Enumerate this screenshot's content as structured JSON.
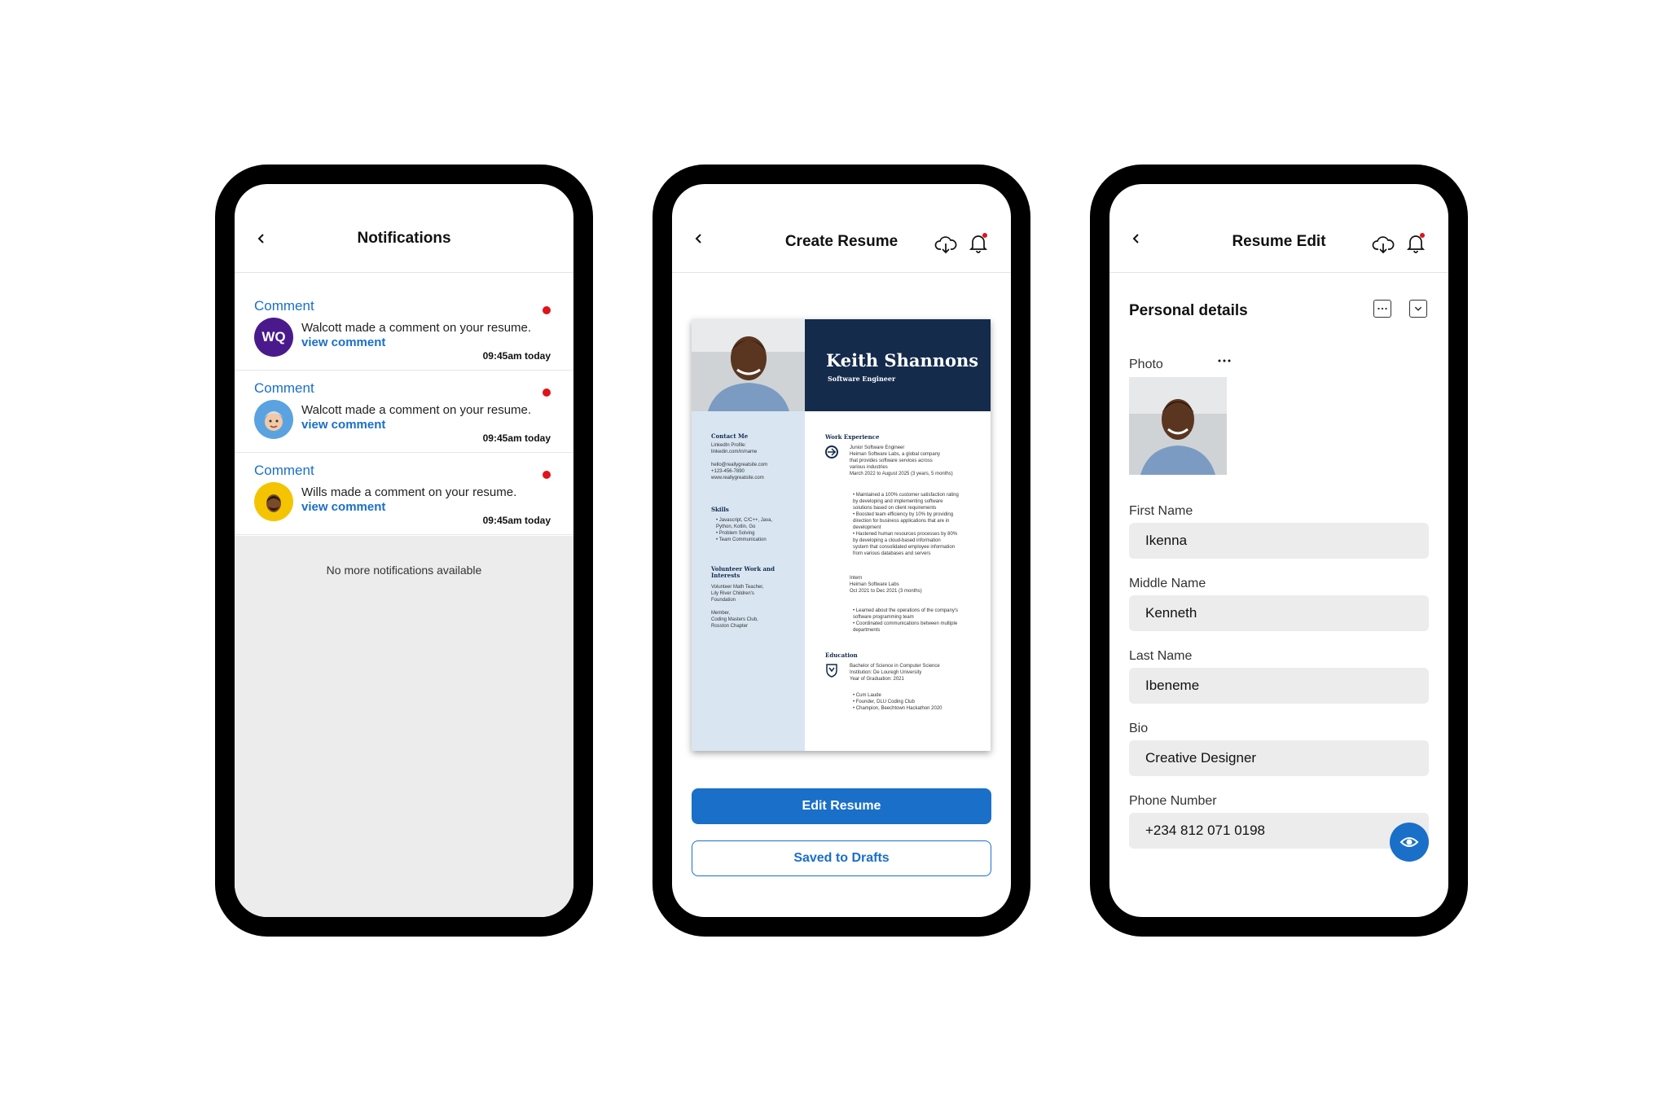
{
  "notifications_screen": {
    "title": "Notifications",
    "items": [
      {
        "type": "Comment",
        "message": "Walcott made a comment on your resume.",
        "link": "view comment",
        "time": "09:45am today",
        "avatar_initials": "WQ",
        "avatar_color": "#4a1a8c"
      },
      {
        "type": "Comment",
        "message": "Walcott made a comment on your resume.",
        "link": "view comment",
        "time": "09:45am today",
        "avatar_color": "#5aa3e0"
      },
      {
        "type": "Comment",
        "message": "Wills made a comment on your resume.",
        "link": "view comment",
        "time": "09:45am today",
        "avatar_color": "#f5c400"
      }
    ],
    "empty_text": "No more notifications available"
  },
  "create_screen": {
    "title": "Create Resume",
    "resume": {
      "name": "Keith Shannons",
      "role": "Software Engineer",
      "contact_title": "Contact Me",
      "contact_lines": "LinkedIn Profile:\nlinkedin.com/in/name\n\nhello@reallygreatsite.com\n+123-456-7890\nwww.reallygreatsite.com",
      "skills_title": "Skills",
      "skills_lines": "•  Javascript, C/C++, Java,\n    Python, Kotlin, Go\n•  Problem Solving\n•  Team Communication",
      "volunteer_title": "Volunteer Work and Interests",
      "volunteer_lines": "Volunteer Math Teacher,\nLily River Children's\nFoundation\n\nMember,\nCoding Masters Club,\nRosston Chapter",
      "work_title": "Work Experience",
      "job1_lines": "Junior Software Engineer\nHeiman Software Labs, a global company\nthat provides software services across\nvarious industries\nMarch 2022 to August 2025 (3 years, 5 months)",
      "job1_bullets": "•  Maintained a 100% customer satisfaction rating\n    by developing and implementing software\n    solutions based on client requirements\n•  Boosted team efficiency by 10% by providing\n    direction for business applications that are in\n    development\n•  Hastened human resources processes by 80%\n    by developing a cloud-based information\n    system that consolidated employee information\n    from various databases and servers",
      "job2_lines": "Intern\nHeiman Software Labs\nOct 2021 to Dec 2021 (3 months)",
      "job2_bullets": "•  Learned about the operations of the company's\n    software programming team\n•  Coordinated communications between multiple\n    departments",
      "edu_title": "Education",
      "edu_lines": "Bachelor of Science in Computer Science\nInstitution: De Louregh University\nYear of Graduation: 2021",
      "edu_bullets": "•  Cum Laude\n•  Founder, DLU Coding Club\n•  Champion, Beechtown Hackathon 2020"
    },
    "edit_button": "Edit Resume",
    "drafts_button": "Saved to Drafts"
  },
  "edit_screen": {
    "title": "Resume Edit",
    "section_title": "Personal details",
    "photo_label": "Photo",
    "fields": [
      {
        "label": "First Name",
        "value": "Ikenna"
      },
      {
        "label": "Middle Name",
        "value": "Kenneth"
      },
      {
        "label": "Last Name",
        "value": "Ibeneme"
      },
      {
        "label": "Bio",
        "value": "Creative Designer"
      },
      {
        "label": "Phone Number",
        "value": "+234 812 071 0198"
      }
    ]
  },
  "colors": {
    "accent": "#1a6fc9",
    "alert": "#e0131b",
    "resume_navy": "#142b4c",
    "resume_side": "#d9e6f2"
  }
}
